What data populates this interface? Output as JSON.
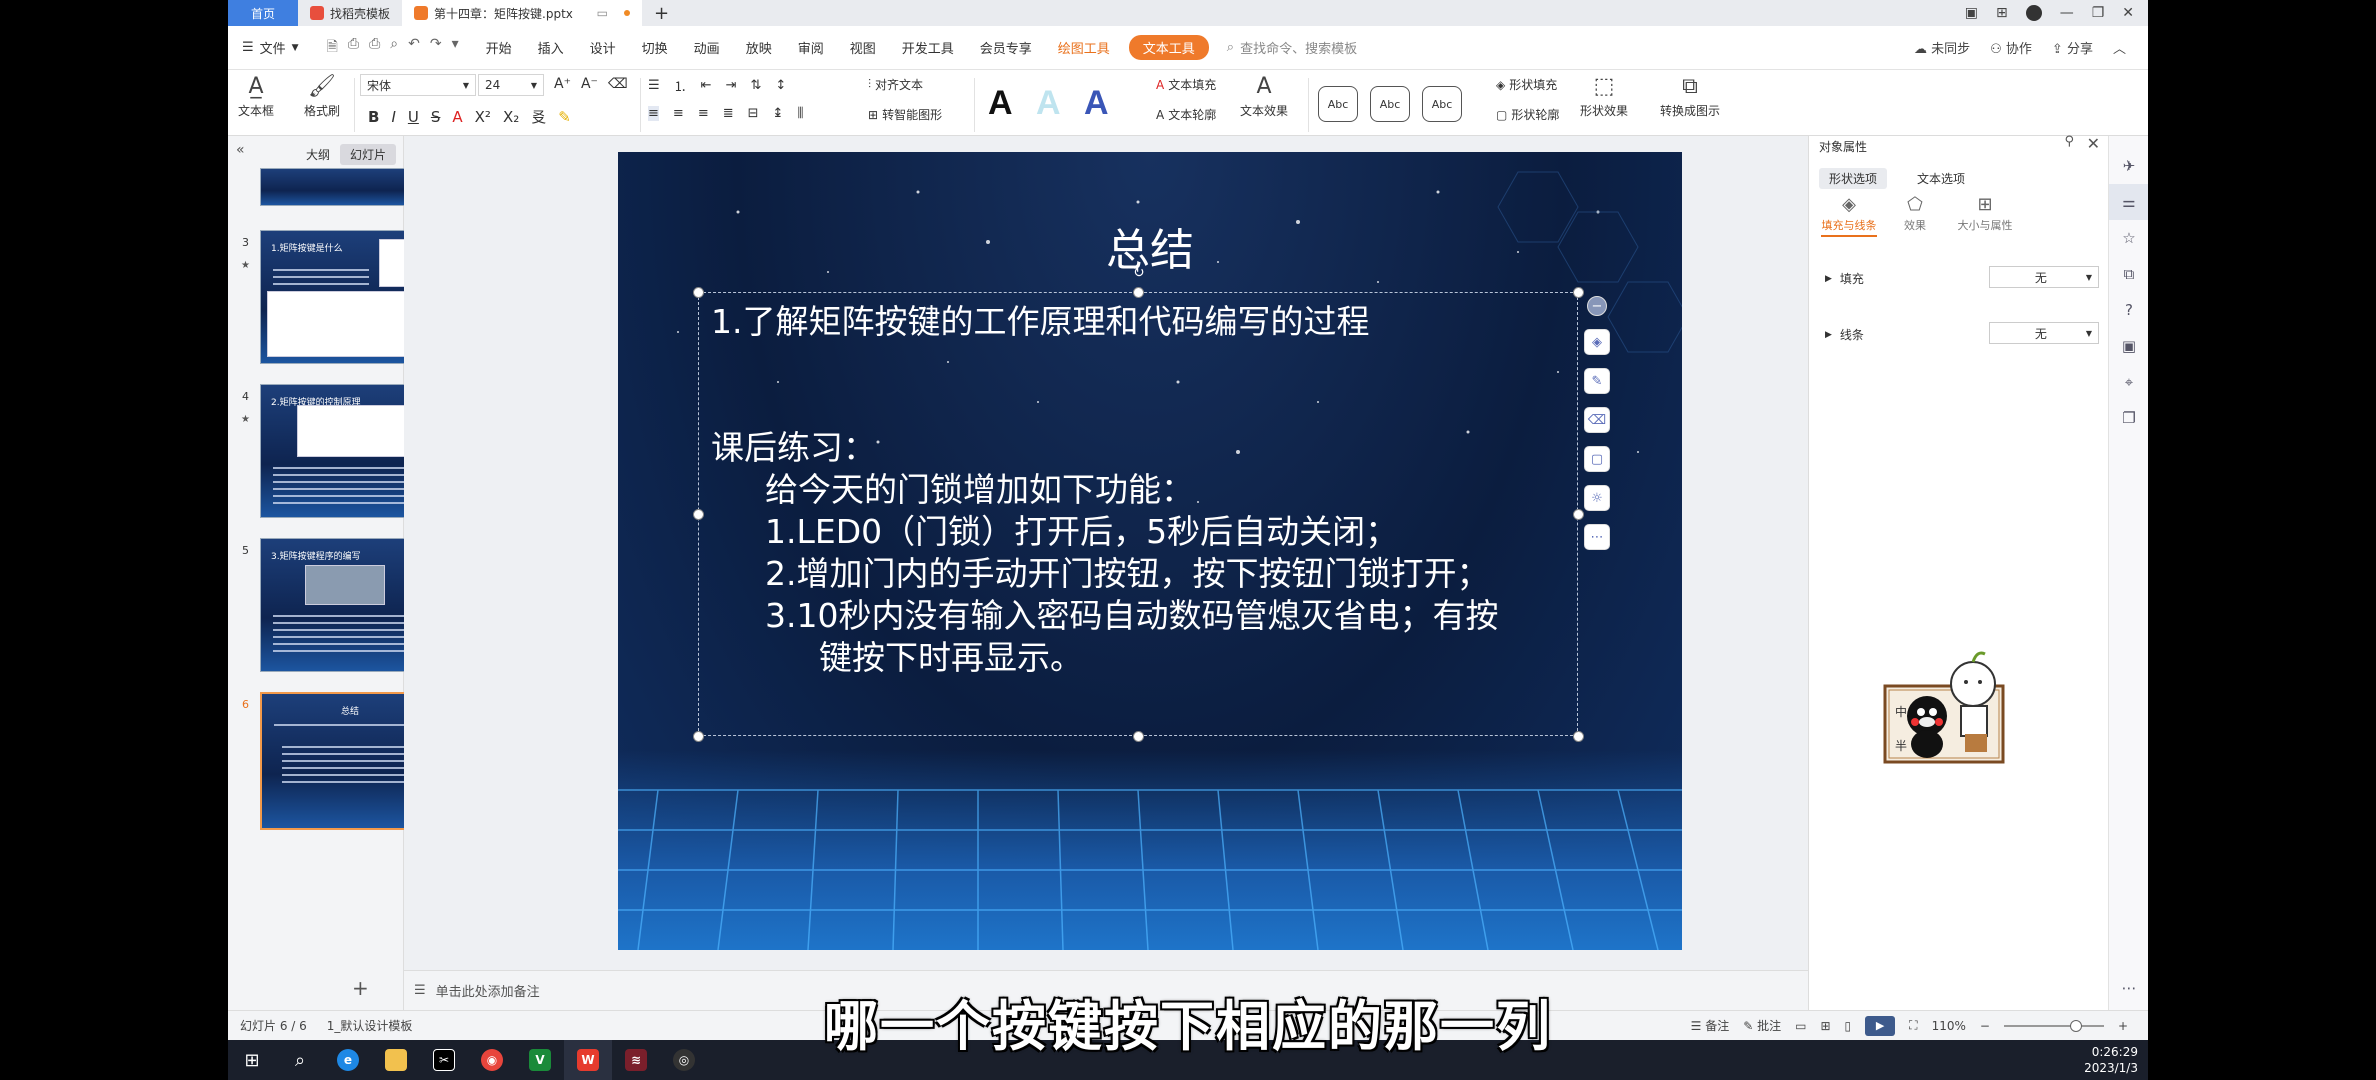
{
  "titlebar": {
    "home_tab": "首页",
    "tabs": [
      {
        "label": "找稻壳模板",
        "color": "#e84f3d"
      },
      {
        "label": "第十四章：矩阵按键.pptx",
        "color": "#ef7a2b"
      }
    ],
    "add_tab": "+"
  },
  "menubar": {
    "file": "文件",
    "items": [
      "开始",
      "插入",
      "设计",
      "切换",
      "动画",
      "放映",
      "审阅",
      "视图",
      "开发工具",
      "会员专享"
    ],
    "draw_tools": "绘图工具",
    "text_tools": "文本工具",
    "search": "查找命令、搜索模板",
    "sync": "未同步",
    "collab": "协作",
    "share": "分享"
  },
  "ribbon": {
    "textbox": "文本框",
    "format_brush": "格式刷",
    "font_name": "宋体",
    "font_size": "24",
    "align_text": "对齐文本",
    "to_smartart": "转智能图形",
    "text_fill": "文本填充",
    "text_outline": "文本轮廓",
    "text_effect": "文本效果",
    "abc": [
      "Abc",
      "Abc",
      "Abc"
    ],
    "shape_fill": "形状填充",
    "shape_outline": "形状轮廓",
    "shape_effect": "形状效果",
    "convert_graphic": "转换成图示"
  },
  "leftpanel": {
    "outline_tab": "大纲",
    "slides_tab": "幻灯片",
    "slides": [
      {
        "num": "3",
        "title": "1.矩阵按键是什么"
      },
      {
        "num": "4",
        "title": "2.矩阵按键的控制原理"
      },
      {
        "num": "5",
        "title": "3.矩阵按键程序的编写"
      },
      {
        "num": "6",
        "title": "总结"
      }
    ],
    "add": "+"
  },
  "slide": {
    "title": "总结",
    "line1": "1.了解矩阵按键的工作原理和代码编写的过程",
    "exercise": "课后练习：",
    "ex_intro": "给今天的门锁增加如下功能：",
    "ex1": "1.LED0（门锁）打开后，5秒后自动关闭；",
    "ex2": "2.增加门内的手动开门按钮，按下按钮门锁打开；",
    "ex3": "3.10秒内没有输入密码自动数码管熄灭省电；有按",
    "ex3b": "键按下时再显示。"
  },
  "notes": {
    "placeholder": "单击此处添加备注"
  },
  "rightpanel": {
    "title": "对象属性",
    "tab_shape": "形状选项",
    "tab_text": "文本选项",
    "sub_fill": "填充与线条",
    "sub_effect": "效果",
    "sub_size": "大小与属性",
    "fill_label": "填充",
    "fill_value": "无",
    "line_label": "线条",
    "line_value": "无"
  },
  "statusbar": {
    "slide_pos": "幻灯片 6 / 6",
    "theme": "1_默认设计模板",
    "notes_btn": "备注",
    "comments_btn": "批注",
    "zoom": "110%"
  },
  "subtitle": "哪一个按键按下相应的那一列",
  "clock": {
    "time": "0:26:29",
    "date": "2023/1/3"
  }
}
